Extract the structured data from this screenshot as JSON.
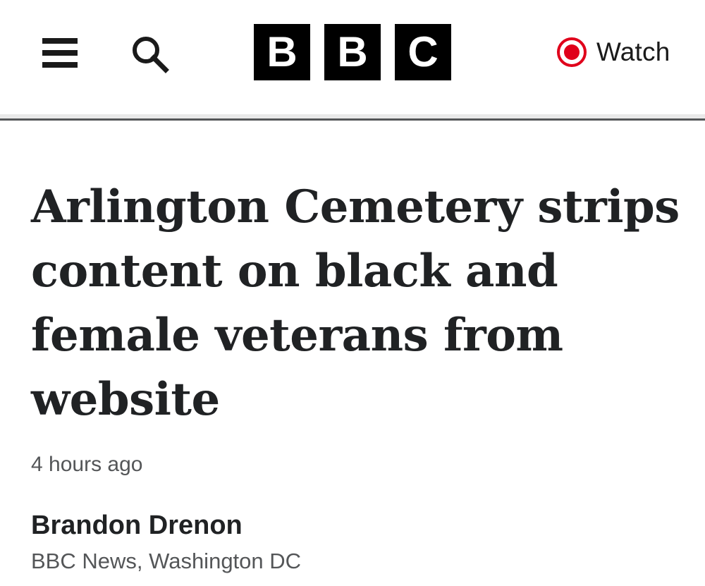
{
  "header": {
    "menu_icon": "hamburger-menu-icon",
    "search_icon": "search-icon",
    "logo": {
      "letters": [
        "B",
        "B",
        "C"
      ]
    },
    "watch": {
      "icon": "live-record-icon",
      "label": "Watch",
      "accent_color": "#e0001b"
    }
  },
  "article": {
    "headline": "Arlington Cemetery strips content on black and female veterans from website",
    "timestamp": "4 hours ago",
    "byline": {
      "name": "Brandon Drenon",
      "role": "BBC News, Washington DC"
    }
  },
  "colors": {
    "text_primary": "#202224",
    "text_secondary": "#545658",
    "logo_bg": "#000000",
    "live_red": "#e0001b"
  }
}
